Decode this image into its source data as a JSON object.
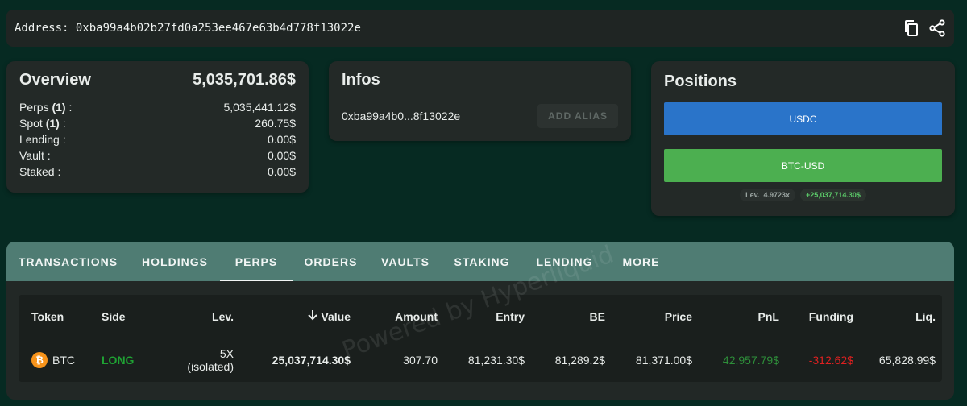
{
  "address_bar": {
    "label": "Address:",
    "address": "0xba99a4b02b27fd0a253ee467e63b4d778f13022e",
    "icons": [
      "copy-icon",
      "share-icon"
    ]
  },
  "overview": {
    "title": "Overview",
    "total": "5,035,701.86$",
    "rows": [
      {
        "label": "Perps",
        "count": "(1)",
        "suffix": " :",
        "value": "5,035,441.12$"
      },
      {
        "label": "Spot",
        "count": "(1)",
        "suffix": " :",
        "value": "260.75$"
      },
      {
        "label": "Lending :",
        "count": "",
        "suffix": "",
        "value": "0.00$"
      },
      {
        "label": "Vault :",
        "count": "",
        "suffix": "",
        "value": "0.00$"
      },
      {
        "label": "Staked :",
        "count": "",
        "suffix": "",
        "value": "0.00$"
      }
    ]
  },
  "infos": {
    "title": "Infos",
    "short_address": "0xba99a4b0...8f13022e",
    "alias_button": "ADD ALIAS"
  },
  "positions": {
    "title": "Positions",
    "items": [
      "USDC",
      "BTC-USD"
    ],
    "colors": {
      "usdc": "#2a74c9",
      "btc": "#4caf50"
    },
    "lev_label": "Lev.",
    "lev_value": "4.9723x",
    "pnl_chip": "+25,037,714.30$"
  },
  "tabs": {
    "items": [
      "TRANSACTIONS",
      "HOLDINGS",
      "PERPS",
      "ORDERS",
      "VAULTS",
      "STAKING",
      "LENDING",
      "MORE"
    ],
    "active": "PERPS"
  },
  "table": {
    "headers": {
      "token": "Token",
      "side": "Side",
      "lev": "Lev.",
      "value": "Value",
      "amount": "Amount",
      "entry": "Entry",
      "be": "BE",
      "price": "Price",
      "pnl": "PnL",
      "funding": "Funding",
      "liq": "Liq."
    },
    "rows": [
      {
        "token": "BTC",
        "side": "LONG",
        "lev": "5X",
        "lev_mode": "(isolated)",
        "value": "25,037,714.30$",
        "amount": "307.70",
        "entry": "81,231.30$",
        "be": "81,289.2$",
        "price": "81,371.00$",
        "pnl": "42,957.79$",
        "funding": "-312.62$",
        "liq": "65,828.99$"
      }
    ]
  },
  "watermark": "Powered by Hyperliquid"
}
